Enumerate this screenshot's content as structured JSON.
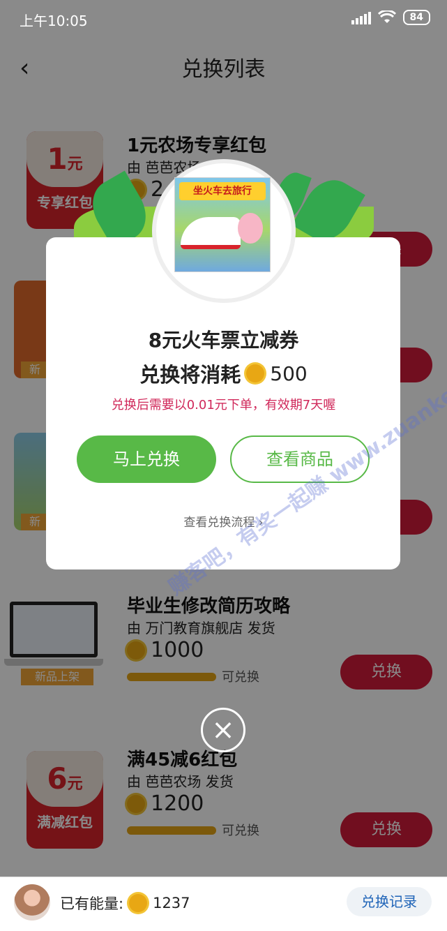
{
  "status_bar": {
    "time": "上午10:05",
    "battery": "84"
  },
  "header": {
    "back": "‹",
    "title": "兑换列表"
  },
  "items": [
    {
      "thumb_amount": "1",
      "thumb_unit": "元",
      "thumb_label": "专享红包",
      "title": "1元农场专享红包",
      "seller": "由 芭芭农场 发货",
      "price": "2",
      "button": "兑换"
    },
    {
      "thumb_label": "新",
      "title": "",
      "seller": "",
      "price": "",
      "button": ""
    },
    {
      "thumb_label": "新",
      "title": "",
      "seller": "",
      "price": "",
      "button": ""
    },
    {
      "thumb_tag": "新品上架",
      "title": "毕业生修改简历攻略",
      "seller": "由 万门教育旗舰店 发货",
      "price": "1000",
      "status": "可兑换",
      "button": "兑换"
    },
    {
      "thumb_amount": "6",
      "thumb_unit": "元",
      "thumb_label": "满减红包",
      "title": "满45减6红包",
      "seller": "由 芭芭农场 发货",
      "price": "1200",
      "status": "可兑换",
      "button": "兑换"
    }
  ],
  "bottom_bar": {
    "energy_label": "已有能量:",
    "energy_value": "1237",
    "record_button": "兑换记录"
  },
  "modal": {
    "image_banner": "坐火车去旅行",
    "title": "8元火车票立减券",
    "cost_label": "兑换将消耗",
    "cost_value": "500",
    "note": "兑换后需要以0.01元下单，有效期7天喔",
    "primary_button": "马上兑换",
    "secondary_button": "查看商品",
    "flow_link": "查看兑换流程 ›",
    "close_icon": "×"
  },
  "watermark": "赚客吧，有奖一起赚 www.zuanke8.com",
  "colors": {
    "accent_red": "#d11a3a",
    "accent_green": "#58b947",
    "note_pink": "#d0285a",
    "link_blue": "#1f64b8"
  }
}
